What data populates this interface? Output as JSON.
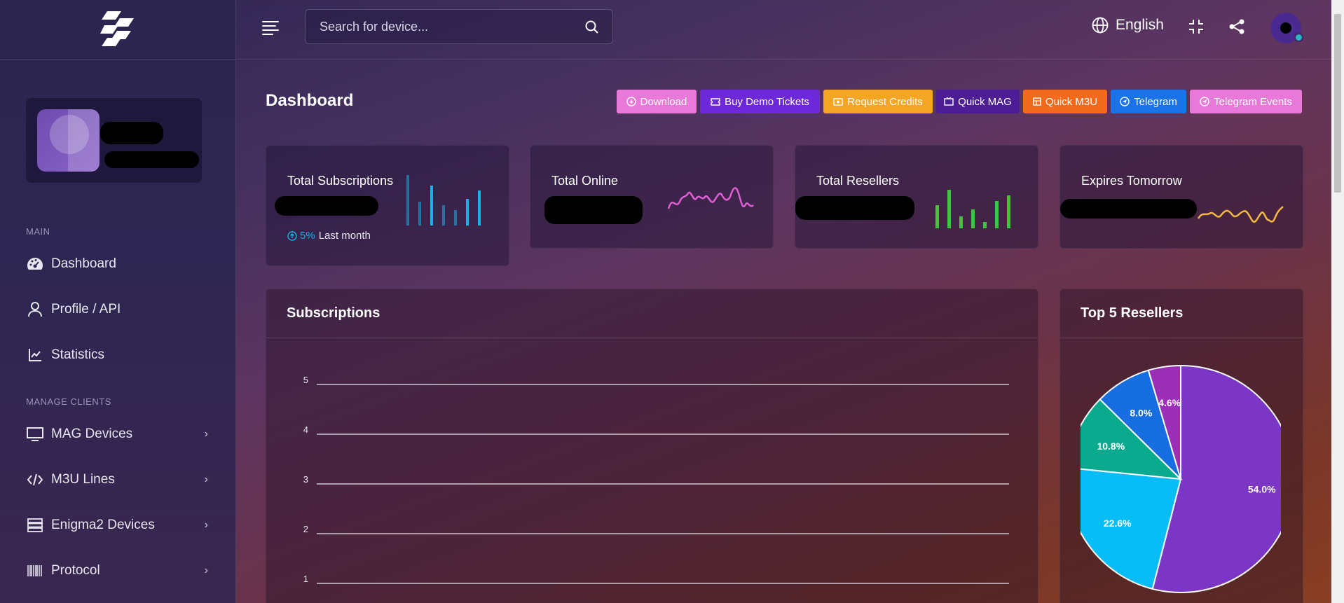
{
  "topbar": {
    "search_placeholder": "Search for device...",
    "language": "English"
  },
  "sidebar": {
    "sections": [
      {
        "label": "MAIN"
      },
      {
        "label": "MANAGE CLIENTS"
      }
    ],
    "items": [
      {
        "label": "Dashboard",
        "icon": "dashboard-icon"
      },
      {
        "label": "Profile / API",
        "icon": "user-icon"
      },
      {
        "label": "Statistics",
        "icon": "chart-line-icon"
      },
      {
        "label": "MAG Devices",
        "icon": "monitor-icon"
      },
      {
        "label": "M3U Lines",
        "icon": "code-icon"
      },
      {
        "label": "Enigma2 Devices",
        "icon": "server-icon"
      },
      {
        "label": "Protocol",
        "icon": "barcode-icon"
      }
    ]
  },
  "header": {
    "title": "Dashboard",
    "buttons": [
      {
        "label": "Download",
        "color": "#e879d9"
      },
      {
        "label": "Buy Demo Tickets",
        "color": "#6d28d9"
      },
      {
        "label": "Request Credits",
        "color": "#f5a524"
      },
      {
        "label": "Quick MAG",
        "color": "#4c1d95"
      },
      {
        "label": "Quick M3U",
        "color": "#f26b1d"
      },
      {
        "label": "Telegram",
        "color": "#1a73e8"
      },
      {
        "label": "Telegram Events",
        "color": "#e879d9"
      }
    ]
  },
  "stats": [
    {
      "title": "Total Subscriptions",
      "trend_value": "5%",
      "trend_label": "Last month",
      "accent": "#1ab0e8"
    },
    {
      "title": "Total Online",
      "accent": "#e05fd6"
    },
    {
      "title": "Total Resellers",
      "accent": "#3fc53f"
    },
    {
      "title": "Expires Tomorrow",
      "accent": "#f5b942"
    }
  ],
  "panels": {
    "subscriptions_title": "Subscriptions",
    "top_resellers_title": "Top 5 Resellers"
  },
  "chart_data": [
    {
      "type": "line",
      "title": "Subscriptions",
      "y_ticks": [
        "5",
        "4",
        "3",
        "2",
        "1"
      ],
      "ylim": [
        1,
        5
      ],
      "grid": true,
      "series": []
    },
    {
      "type": "pie",
      "title": "Top 5 Resellers",
      "slices": [
        {
          "label": "54.0%",
          "value": 54.0,
          "color": "#7b36c6"
        },
        {
          "label": "22.6%",
          "value": 22.6,
          "color": "#08bdf5"
        },
        {
          "label": "10.8%",
          "value": 10.8,
          "color": "#0aaa8f"
        },
        {
          "label": "8.0%",
          "value": 8.0,
          "color": "#166ee0"
        },
        {
          "label": "4.6%",
          "value": 4.6,
          "color": "#9b2fb8"
        }
      ]
    }
  ]
}
